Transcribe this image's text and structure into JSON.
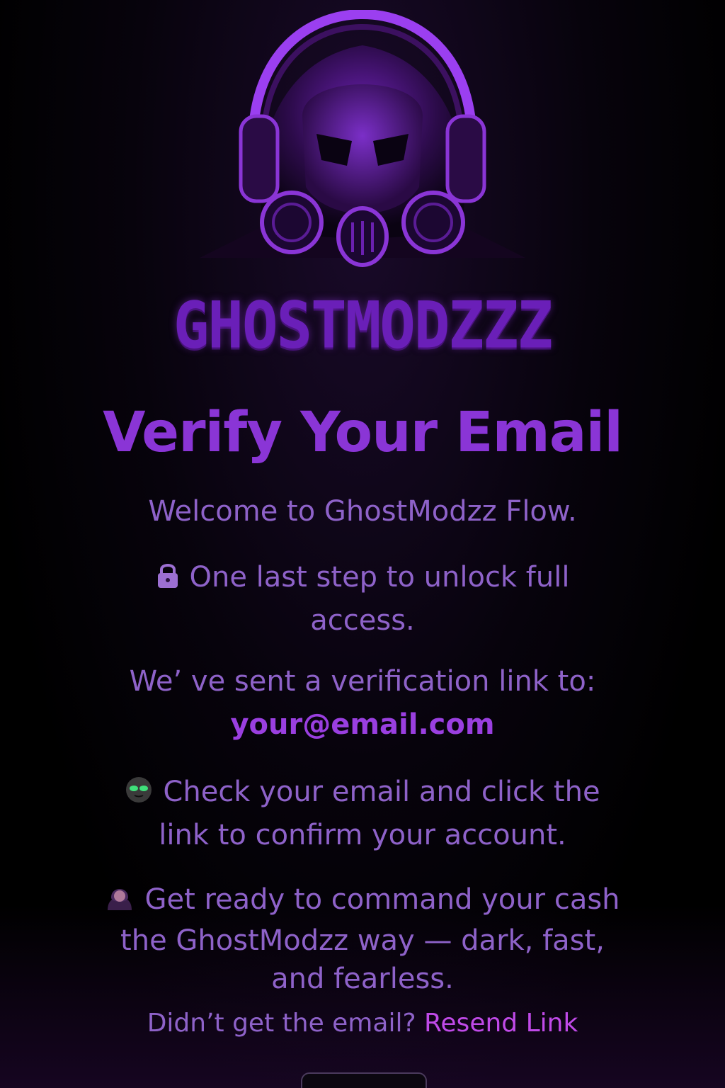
{
  "brand": {
    "name": "GHOSTMODZZZ",
    "logo_icon": "gas-mask-skull-headphones-icon",
    "accent_color": "#8a35d6"
  },
  "page": {
    "title": "Verify Your Email",
    "welcome": "Welcome to GhostModzz Flow.",
    "unlock_text": "One last step to unlock full access.",
    "unlock_icon": "lock-icon",
    "sent_text": "We’ ve sent a verification link to:",
    "email": "your@email.com",
    "check_text": "Check your email and click the link to confirm your account.",
    "check_icon": "alien-face-icon",
    "ready_text": "Get ready to command your cash the GhostModzz way — dark, fast, and fearless.",
    "ready_icon": "hooded-figure-icon"
  },
  "footer": {
    "prompt": "Didn’t get the email?",
    "resend_label": "Resend Link"
  },
  "colors": {
    "text": "#8e62c9",
    "link": "#c04ae8",
    "background": "#000000"
  }
}
